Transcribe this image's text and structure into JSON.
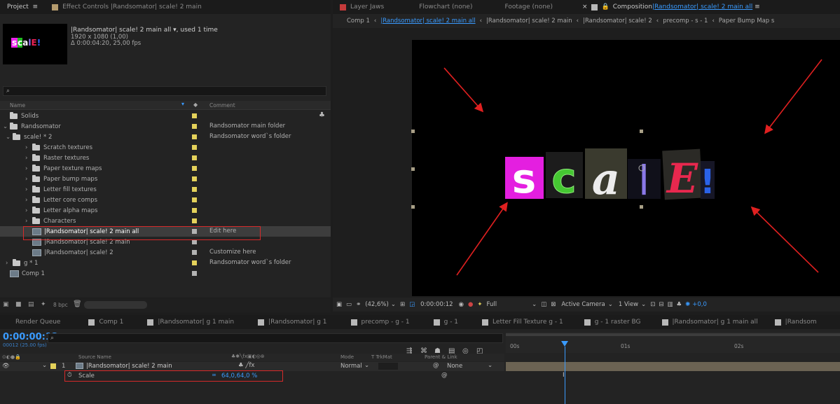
{
  "project_panel": {
    "tab_project": "Project",
    "tab_effect": "Effect Controls |Randsomator| scale! 2 main",
    "comp_name": "|Randsomator| scale! 2 main all",
    "comp_used": ", used 1 time",
    "comp_res": "1920 x 1080 (1,00)",
    "comp_dur": "Δ 0:00:04:20, 25,00 fps",
    "thumb_text": "scale!",
    "search_placeholder": "",
    "col_name": "Name",
    "col_comment": "Comment",
    "bpc": "8 bpc",
    "items": [
      {
        "label": "Solids",
        "comment": "",
        "indent": 0
      },
      {
        "label": "Randsomator",
        "comment": "Randsomator main folder",
        "indent": 0
      },
      {
        "label": "scale! * 2",
        "comment": "Randsomator word`s folder",
        "indent": 1
      },
      {
        "label": "Scratch textures",
        "comment": "",
        "indent": 2
      },
      {
        "label": "Raster textures",
        "comment": "",
        "indent": 2
      },
      {
        "label": "Paper texture maps",
        "comment": "",
        "indent": 2
      },
      {
        "label": "Paper bump maps",
        "comment": "",
        "indent": 2
      },
      {
        "label": "Letter fill textures",
        "comment": "",
        "indent": 2
      },
      {
        "label": "Letter core comps",
        "comment": "",
        "indent": 2
      },
      {
        "label": "Letter alpha maps",
        "comment": "",
        "indent": 2
      },
      {
        "label": "Characters",
        "comment": "",
        "indent": 2
      },
      {
        "label": "|Randsomator| scale! 2 main all",
        "comment": "Edit here",
        "indent": 2
      },
      {
        "label": "|Randsomator| scale! 2 main",
        "comment": "",
        "indent": 2
      },
      {
        "label": "|Randsomator| scale! 2",
        "comment": "Customize here",
        "indent": 2
      },
      {
        "label": "g * 1",
        "comment": "Randsomator word`s folder",
        "indent": 1
      },
      {
        "label": "Comp 1",
        "comment": "",
        "indent": 0
      }
    ]
  },
  "comp_panel": {
    "tab_layer": "Layer Jaws",
    "tab_flowchart": "Flowchart (none)",
    "tab_footage": "Footage (none)",
    "tab_comp_prefix": "Composition ",
    "tab_comp_name": "|Randsomator| scale! 2 main all",
    "crumbs": [
      "Comp 1",
      "|Randsomator| scale! 2 main all",
      "|Randsomator| scale! 2 main",
      "|Randsomator| scale! 2",
      "precomp - s - 1",
      "Paper Bump Map s"
    ],
    "zoom": "(42,6%)",
    "timecode": "0:00:00:12",
    "resolution": "Full",
    "camera": "Active Camera",
    "views": "1 View",
    "exposure": "+0,0",
    "letters": [
      "s",
      "c",
      "a",
      "l",
      "E",
      "!"
    ]
  },
  "timeline": {
    "tabs": [
      "Render Queue",
      "Comp 1",
      "|Randsomator| g 1 main",
      "|Randsomator| g 1",
      "precomp - g - 1",
      "g - 1",
      "Letter Fill Texture g - 1",
      "g - 1 raster BG",
      "|Randsomator| g 1 main all",
      "|Randsom"
    ],
    "time": "0:00:00:12",
    "frames": "00012 (25.00 fps)",
    "col_source": "Source Name",
    "col_mode": "Mode",
    "col_trkmat": "T  TrkMat",
    "col_parent": "Parent & Link",
    "layer_num": "1",
    "layer_name": "|Randsomator| scale! 2 main",
    "mode": "Normal",
    "parent": "None",
    "prop_name": "Scale",
    "prop_value": "64,0,64,0 %",
    "ruler": [
      "00s",
      "01s",
      "02s"
    ]
  },
  "colors": {
    "accent": "#3a9bff",
    "label_yellow": "#e4d15a",
    "highlight_red": "#d62a2a",
    "arrow_red": "#e02020"
  }
}
